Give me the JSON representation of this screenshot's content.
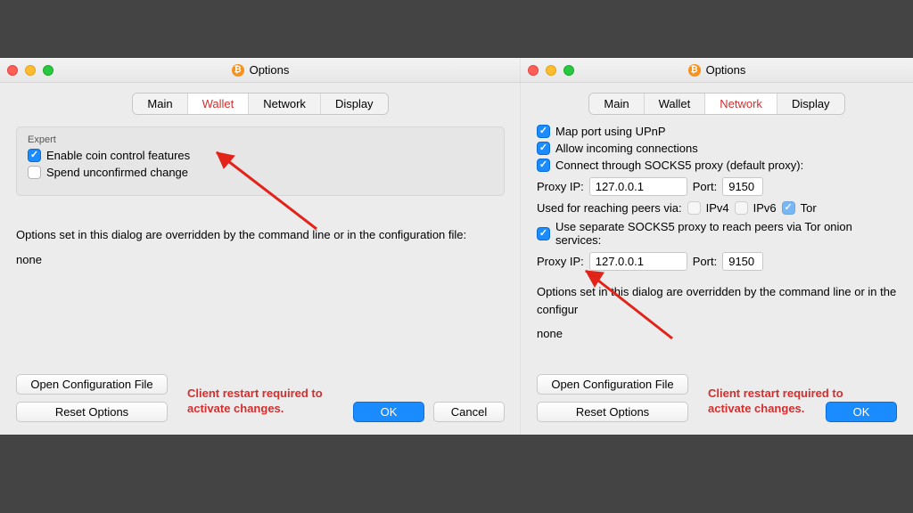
{
  "window_title": "Options",
  "tabs": {
    "main": "Main",
    "wallet": "Wallet",
    "network": "Network",
    "display": "Display"
  },
  "left": {
    "group_label": "Expert",
    "enable_coin_control": "Enable coin control features",
    "spend_unconfirmed": "Spend unconfirmed change"
  },
  "right": {
    "map_upnp": "Map port using UPnP",
    "allow_incoming": "Allow incoming connections",
    "socks5_default": "Connect through SOCKS5 proxy (default proxy):",
    "proxy_ip_label": "Proxy IP:",
    "proxy_ip_value": "127.0.0.1",
    "port_label": "Port:",
    "port_value": "9150",
    "used_for": "Used for reaching peers via:",
    "ipv4": "IPv4",
    "ipv6": "IPv6",
    "tor": "Tor",
    "socks5_tor": "Use separate SOCKS5 proxy to reach peers via Tor onion services:",
    "proxy_ip2_value": "127.0.0.1",
    "port2_value": "9150"
  },
  "footer": {
    "override_msg_left": "Options set in this dialog are overridden by the command line or in the configuration file:",
    "override_msg_right": "Options set in this dialog are overridden by the command line or in the configur",
    "none": "none",
    "open_config": "Open Configuration File",
    "reset_options": "Reset Options",
    "restart_msg": "Client restart required to activate changes.",
    "ok": "OK",
    "cancel": "Cancel"
  }
}
